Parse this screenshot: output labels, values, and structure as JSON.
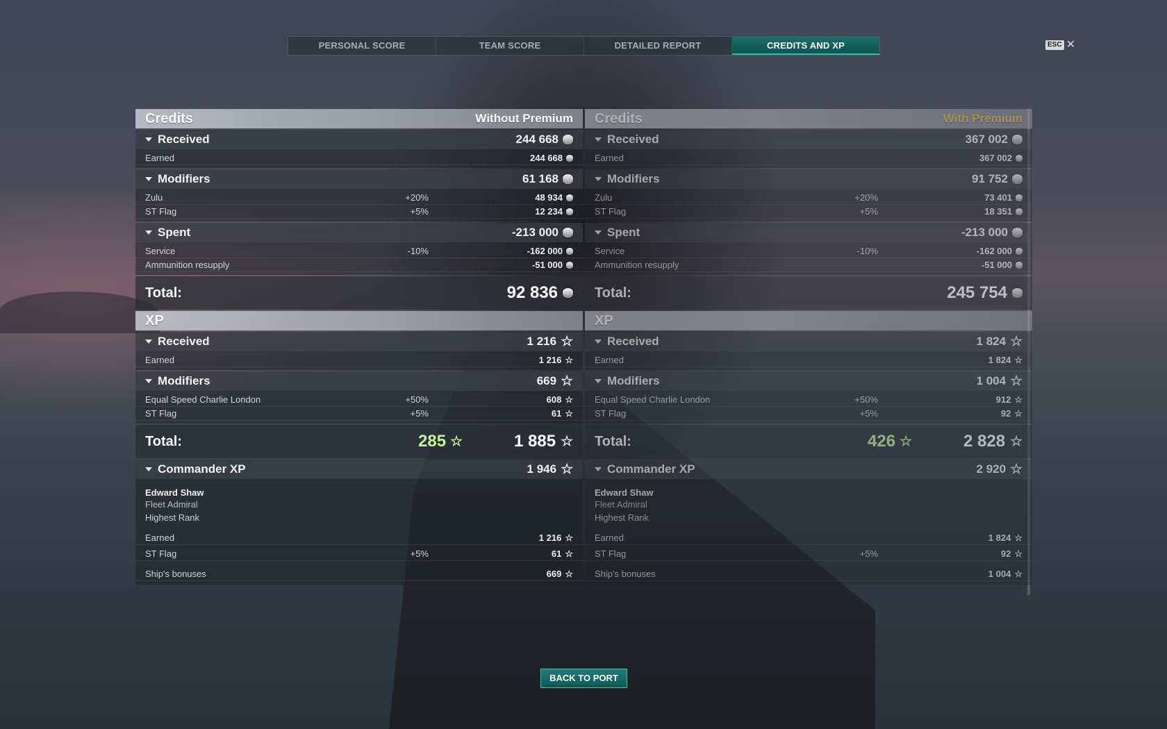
{
  "tabs": [
    {
      "label": "PERSONAL SCORE"
    },
    {
      "label": "TEAM SCORE"
    },
    {
      "label": "DETAILED REPORT"
    },
    {
      "label": "CREDITS AND XP"
    }
  ],
  "esc": {
    "key": "ESC",
    "close": "✕"
  },
  "panels": {
    "left": {
      "credits_title": "Credits",
      "premium_label": "Without Premium",
      "received": {
        "label": "Received",
        "value": "244 668"
      },
      "earned": {
        "label": "Earned",
        "value": "244 668"
      },
      "modifiers": {
        "label": "Modifiers",
        "value": "61 168"
      },
      "zulu": {
        "label": "Zulu",
        "pct": "+20%",
        "value": "48 934"
      },
      "st_flag_credits": {
        "label": "ST Flag",
        "pct": "+5%",
        "value": "12 234"
      },
      "spent": {
        "label": "Spent",
        "value": "-213 000"
      },
      "service": {
        "label": "Service",
        "pct": "-10%",
        "value": "-162 000"
      },
      "ammo": {
        "label": "Ammunition resupply",
        "value": "-51 000"
      },
      "credits_total": {
        "label": "Total:",
        "value": "92 836"
      },
      "xp_title": "XP",
      "xp_received": {
        "label": "Received",
        "value": "1 216"
      },
      "xp_earned": {
        "label": "Earned",
        "value": "1 216"
      },
      "xp_modifiers": {
        "label": "Modifiers",
        "value": "669"
      },
      "escl": {
        "label": "Equal Speed Charlie London",
        "pct": "+50%",
        "value": "608"
      },
      "st_flag_xp": {
        "label": "ST Flag",
        "pct": "+5%",
        "value": "61"
      },
      "xp_total": {
        "label": "Total:",
        "free": "285",
        "value": "1 885"
      },
      "commander": {
        "label": "Commander XP",
        "value": "1 946",
        "name": "Edward Shaw",
        "rank": "Fleet Admiral",
        "status": "Highest Rank",
        "earned": {
          "label": "Earned",
          "value": "1 216"
        },
        "st_flag": {
          "label": "ST Flag",
          "pct": "+5%",
          "value": "61"
        },
        "ship_bonus": {
          "label": "Ship's bonuses",
          "value": "669"
        }
      }
    },
    "right": {
      "credits_title": "Credits",
      "premium_label": "With Premium",
      "received": {
        "label": "Received",
        "value": "367 002"
      },
      "earned": {
        "label": "Earned",
        "value": "367 002"
      },
      "modifiers": {
        "label": "Modifiers",
        "value": "91 752"
      },
      "zulu": {
        "label": "Zulu",
        "pct": "+20%",
        "value": "73 401"
      },
      "st_flag_credits": {
        "label": "ST Flag",
        "pct": "+5%",
        "value": "18 351"
      },
      "spent": {
        "label": "Spent",
        "value": "-213 000"
      },
      "service": {
        "label": "Service",
        "pct": "-10%",
        "value": "-162 000"
      },
      "ammo": {
        "label": "Ammunition resupply",
        "value": "-51 000"
      },
      "credits_total": {
        "label": "Total:",
        "value": "245 754"
      },
      "xp_title": "XP",
      "xp_received": {
        "label": "Received",
        "value": "1 824"
      },
      "xp_earned": {
        "label": "Earned",
        "value": "1 824"
      },
      "xp_modifiers": {
        "label": "Modifiers",
        "value": "1 004"
      },
      "escl": {
        "label": "Equal Speed Charlie London",
        "pct": "+50%",
        "value": "912"
      },
      "st_flag_xp": {
        "label": "ST Flag",
        "pct": "+5%",
        "value": "92"
      },
      "xp_total": {
        "label": "Total:",
        "free": "426",
        "value": "2 828"
      },
      "commander": {
        "label": "Commander XP",
        "value": "2 920",
        "name": "Edward Shaw",
        "rank": "Fleet Admiral",
        "status": "Highest Rank",
        "earned": {
          "label": "Earned",
          "value": "1 824"
        },
        "st_flag": {
          "label": "ST Flag",
          "pct": "+5%",
          "value": "92"
        },
        "ship_bonus": {
          "label": "Ship's bonuses",
          "value": "1 004"
        }
      }
    }
  },
  "back_button": "BACK TO PORT",
  "colors": {
    "accent_teal": "#1a6f6a",
    "premium_gold": "#e8b85a",
    "free_xp_green": "#c6f29a"
  }
}
